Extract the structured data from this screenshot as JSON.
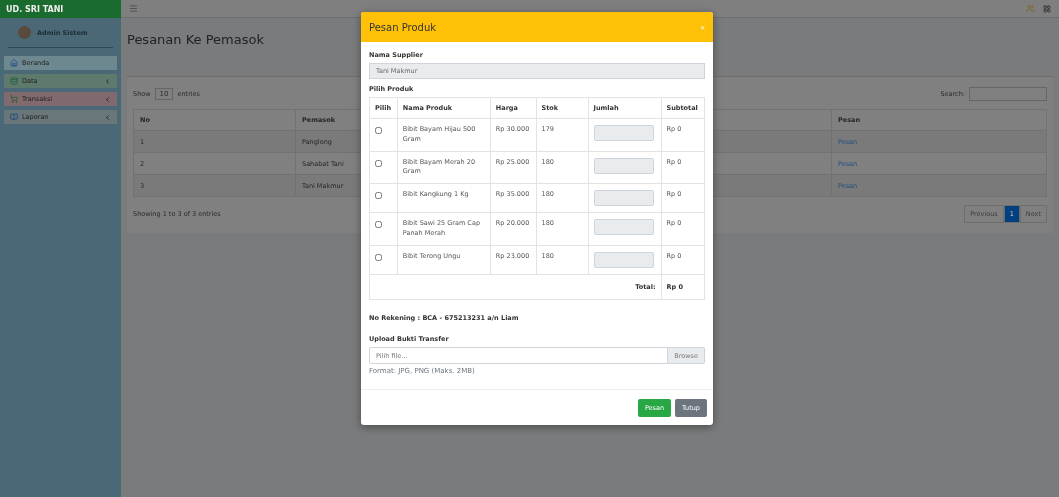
{
  "brand": "UD. SRI TANI",
  "user": {
    "name": "Admin Sistem"
  },
  "sidebar": {
    "items": [
      {
        "label": "Beranda",
        "expandable": false,
        "color": "#6e8890"
      },
      {
        "label": "Data",
        "expandable": true,
        "color": "#5e7a6c"
      },
      {
        "label": "Transaksi",
        "expandable": true,
        "color": "#806a6e"
      },
      {
        "label": "Laporan",
        "expandable": true,
        "color": "#69767a"
      }
    ]
  },
  "page": {
    "title": "Pesanan Ke Pemasok",
    "show_label": "Show",
    "show_value": "10",
    "entries_label": "entries",
    "search_label": "Search:",
    "table": {
      "columns": [
        "No",
        "Pemasok",
        "Pesan"
      ],
      "rows": [
        {
          "no": "1",
          "pemasok": "Panglong",
          "action": "Pesan"
        },
        {
          "no": "2",
          "pemasok": "Sahabat Tani",
          "action": "Pesan"
        },
        {
          "no": "3",
          "pemasok": "Tani Makmur",
          "action": "Pesan"
        }
      ]
    },
    "info": "Showing 1 to 3 of 3 entries",
    "pagination": [
      {
        "label": "Previous",
        "selected": false
      },
      {
        "label": "1",
        "selected": true
      },
      {
        "label": "Next",
        "selected": false
      }
    ]
  },
  "modal": {
    "title": "Pesan Produk",
    "close": "×",
    "supplier_label": "Nama Supplier",
    "supplier_value": "Tani Makmur",
    "product_label": "Pilih Produk",
    "columns": [
      "Pilih",
      "Nama Produk",
      "Harga",
      "Stok",
      "Jumlah",
      "Subtotal"
    ],
    "rows": [
      {
        "checked": false,
        "name": "Bibit Bayam Hijau 500 Gram",
        "price": "Rp 30.000",
        "stock": "179",
        "subtotal": "Rp 0"
      },
      {
        "checked": false,
        "name": "Bibit Bayam Merah 20 Gram",
        "price": "Rp 25.000",
        "stock": "180",
        "subtotal": "Rp 0"
      },
      {
        "checked": false,
        "name": "Bibit Kangkung 1 Kg",
        "price": "Rp 35.000",
        "stock": "180",
        "subtotal": "Rp 0"
      },
      {
        "checked": false,
        "name": "Bibit Sawi 25 Gram Cap Panah Merah",
        "price": "Rp 20.000",
        "stock": "180",
        "subtotal": "Rp 0"
      },
      {
        "checked": false,
        "name": "Bibit Terong Ungu",
        "price": "Rp 23.000",
        "stock": "180",
        "subtotal": "Rp 0"
      }
    ],
    "total_label": "Total:",
    "total_value": "Rp 0",
    "account": "No Rekening : BCA - 675213231 a/n Liam",
    "upload_label": "Upload Bukti Transfer",
    "file_placeholder": "Pilih file...",
    "browse": "Browse",
    "hint": "Format: JPG, PNG (Maks. 2MB)",
    "buttons": [
      {
        "label": "Pesan",
        "kind": "primary"
      },
      {
        "label": "Tutup",
        "kind": "secondary"
      }
    ]
  }
}
